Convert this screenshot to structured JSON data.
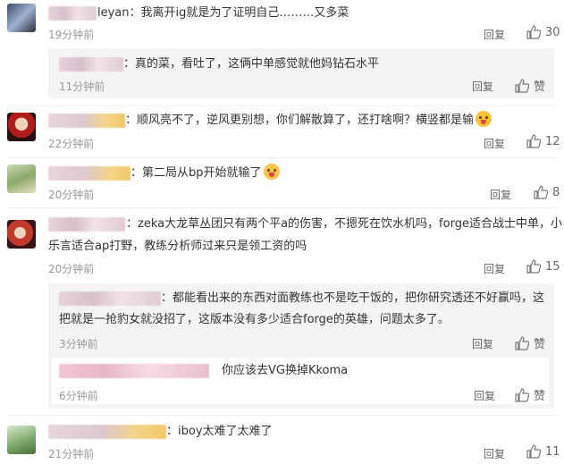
{
  "comments": [
    {
      "text_prefix": "：",
      "text": "leyan：我离开ig就是为了证明自己………又多菜",
      "time": "19分钟前",
      "reply": "回复",
      "likes": "30",
      "replies": [
        {
          "text": "：真的菜，看吐了，这俩中单感觉就他妈钻石水平",
          "time": "11分钟前",
          "reply": "回复",
          "like_label": "赞"
        }
      ]
    },
    {
      "text": "：顺风亮不了，逆风更别想，你们解散算了，还打啥啊？横竖都是输",
      "time": "22分钟前",
      "reply": "回复",
      "likes": "12"
    },
    {
      "text": "：第二局从bp开始就输了",
      "time": "20分钟前",
      "reply": "回复",
      "likes": "8"
    },
    {
      "text_line1": "：zeka大龙草丛团只有两个平a的伤害，不摁死在饮水机吗，forge适合战士中单，小",
      "text_line2": "乐言适合ap打野，教练分析师过来只是领工资的吗",
      "time": "20分钟前",
      "reply": "回复",
      "likes": "15",
      "replies": [
        {
          "text_line1": "：都能看出来的东西对面教练也不是吃干饭的，把你研究透还不好赢吗，这",
          "text_line2": "把就是一抢豹女就没招了，这版本没有多少适合forge的英雄，问题太多了。",
          "time": "3分钟前",
          "reply": "回复",
          "like_label": "赞"
        },
        {
          "text": "你应该去VG换掉Kkoma",
          "time": "6分钟前",
          "reply": "回复",
          "like_label": "赞"
        }
      ]
    },
    {
      "text": "：iboy太难了太难了",
      "time": "21分钟前",
      "reply": "回复",
      "likes": "11"
    }
  ],
  "icons": {
    "like": "thumbs-up-icon",
    "emoji_grin": "grin-emoji-icon",
    "emoji_sweat": "sweat-emoji-icon"
  }
}
